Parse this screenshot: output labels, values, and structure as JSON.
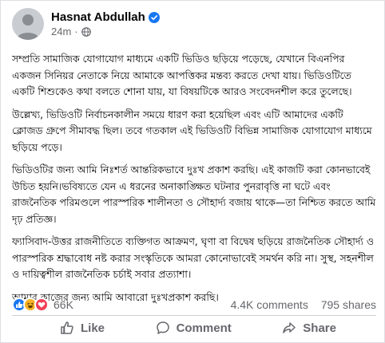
{
  "post": {
    "author": "Hasnat Abdullah",
    "time": "24m",
    "separator": "·",
    "paragraphs": [
      "সম্প্রতি সামাজিক যোগাযোগ মাধ্যমে একটি ভিডিও ছড়িয়ে পড়েছে, যেখানে বিএনপির একজন সিনিয়র নেতাকে নিয়ে আমাকে আপত্তিকর মন্তব্য করতে দেখা যায়। ভিডিওটিতে একটি শিশুকেও কথা বলতে শোনা যায়, যা বিষয়টিকে আরও সংবেদনশীল করে তুলেছে।",
      "উল্লেখ্য, ভিডিওটি নির্বাচনকালীন সময়ে ধারণ করা হয়েছিল এবং এটি আমাদের একটি ক্লোজড গ্রুপে সীমাবদ্ধ ছিল। তবে গতকাল এই ভিডিওটি বিভিন্ন সামাজিক যোগাযোগ মাধ্যমে ছড়িয়ে পড়ে।",
      "ভিডিওটির জন্য আমি নিঃশর্ত আন্তরিকভাবে দুঃখ প্রকাশ করছি। এই কাজটি করা কোনভাবেই উচিত হয়নি।ভবিষ্যতে যেন এ ধরনের অনাকাঙ্ক্ষিত ঘটনার পুনরাবৃত্তি না ঘটে এবং রাজনৈতিক পরিমণ্ডলে পারস্পরিক শালীনতা ও সৌহার্দ্য বজায় থাকে—তা নিশ্চিত করতে আমি দৃঢ় প্রতিজ্ঞ।",
      "ফ্যাসিবাদ-উত্তর রাজনীতিতে ব্যক্তিগত আক্রমণ, ঘৃণা বা বিদ্বেষ ছড়িয়ে রাজনৈতিক সৌহার্দ্য ও পারস্পরিক শ্রদ্ধাবোধ নষ্ট করার সংস্কৃতিকে আমরা কোনোভাবেই সমর্থন করি না। সুস্থ, সহনশীল ও দায়িত্বশীল রাজনৈতিক চর্চাই সবার প্রত্যাশা।",
      "আমার কাজের জন্য আমি আবারো দুঃখপ্রকাশ করছি।"
    ]
  },
  "stats": {
    "reactions": "66K",
    "comments": "4.4K comments",
    "shares": "795 shares"
  },
  "actions": {
    "like": "Like",
    "comment": "Comment",
    "share": "Share"
  },
  "icons": {
    "verified": "verified-badge-icon",
    "globe": "globe-icon",
    "like": "like-reaction-icon",
    "haha": "haha-reaction-icon",
    "love": "love-reaction-icon"
  },
  "colors": {
    "verified": "#1877f2",
    "like_reaction": "#1877f2",
    "haha_reaction": "#f7b125",
    "love_reaction": "#f33e58",
    "secondary_text": "#65676b"
  }
}
